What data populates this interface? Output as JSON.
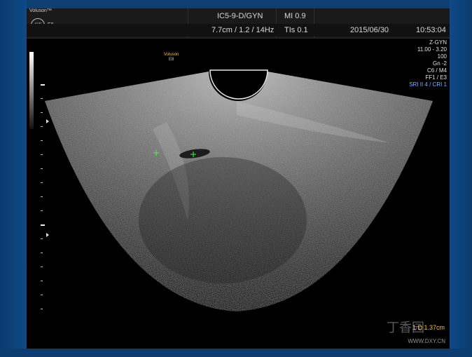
{
  "header": {
    "brand": "Voluson™",
    "logo": "GE",
    "model": "E8",
    "probe": "IC5-9-D/GYN",
    "mi": "MI  0.9",
    "settings": "7.7cm / 1.2 / 14Hz",
    "tis": "TIs  0.1",
    "date": "2015/06/30",
    "time": "10:53:04"
  },
  "params": [
    "Z-GYN",
    "11.00 - 3.20",
    "100",
    "Gn  -2",
    "C6 / M4",
    "FF1 / E3",
    "SRI II 4 / CRI 1"
  ],
  "probe_label": [
    "Voluson",
    "E8"
  ],
  "measurement": "1  D 1.37cm",
  "watermark": {
    "site": "WWW.DXY.CN",
    "logo_text": "丁香园"
  },
  "colors": {
    "frame": "#0d3f73",
    "measure": "#f0c040",
    "caliper": "#3cff3c",
    "blue_param": "#7fb0ff"
  }
}
